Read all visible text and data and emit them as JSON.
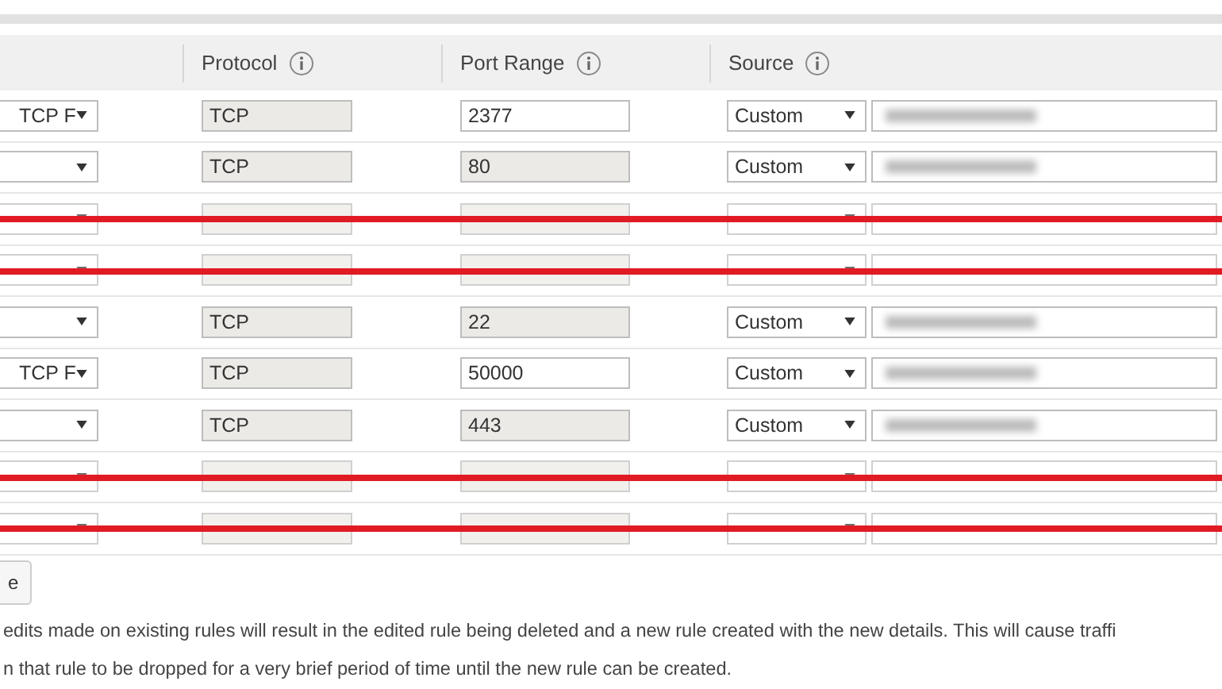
{
  "table": {
    "columns": [
      {
        "label": "Protocol"
      },
      {
        "label": "Port Range"
      },
      {
        "label": "Source"
      }
    ],
    "rows": [
      {
        "type": "TCP F",
        "protocol": "TCP",
        "port": "2377",
        "port_editable": true,
        "source": "Custom",
        "source_value_redacted": true,
        "struck": false
      },
      {
        "type": "",
        "protocol": "TCP",
        "port": "80",
        "port_editable": false,
        "source": "Custom",
        "source_value_redacted": true,
        "struck": false
      },
      {
        "port_editable": false,
        "struck": true
      },
      {
        "port_editable": false,
        "struck": true
      },
      {
        "type": "",
        "protocol": "TCP",
        "port": "22",
        "port_editable": false,
        "source": "Custom",
        "source_value_redacted": true,
        "struck": false
      },
      {
        "type": "TCP F",
        "protocol": "TCP",
        "port": "50000",
        "port_editable": true,
        "source": "Custom",
        "source_value_redacted": true,
        "struck": false
      },
      {
        "type": "",
        "protocol": "TCP",
        "port": "443",
        "port_editable": false,
        "source": "Custom",
        "source_value_redacted": true,
        "struck": false
      },
      {
        "port_editable": false,
        "struck": true
      },
      {
        "port_editable": false,
        "struck": true
      }
    ]
  },
  "button": {
    "label": "e"
  },
  "notice": [
    "edits made on existing rules will result in the edited rule being deleted and a new rule created with the new details. This will cause traffi",
    "n that rule to be dropped for a very brief period of time until the new rule can be created."
  ]
}
